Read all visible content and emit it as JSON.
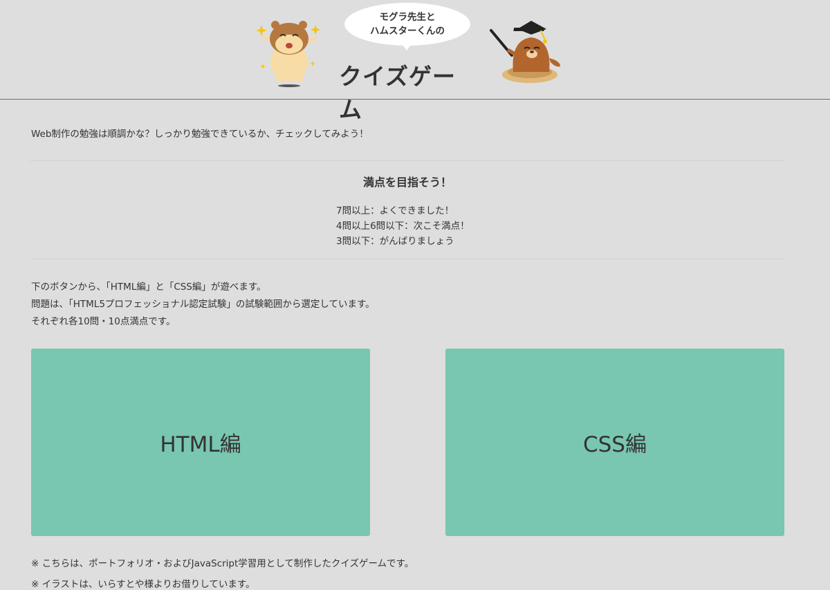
{
  "header": {
    "bubble_line1": "モグラ先生と",
    "bubble_line2": "ハムスターくんの",
    "title": "クイズゲーム"
  },
  "intro": "Web制作の勉強は順調かな？しっかり勉強できているか、チェックしてみよう！",
  "score": {
    "heading": "満点を目指そう！",
    "levels": [
      "7問以上：よくできました！",
      "4問以上6問以下：次こそ満点！",
      "3問以下：がんばりましょう"
    ]
  },
  "description": [
    "下のボタンから、「HTML編」と「CSS編」が遊べます。",
    "問題は、「HTML5プロフェッショナル認定試験」の試験範囲から選定しています。",
    "それぞれ各10問・10点満点です。"
  ],
  "buttons": {
    "html": "HTML編",
    "css": "CSS編"
  },
  "notes": [
    "※ こちらは、ポートフォリオ・およびJavaScript学習用として制作したクイズゲームです。",
    "※ イラストは、いらすとや様よりお借りしています。"
  ],
  "colors": {
    "background": "#dedede",
    "button": "#79c6b1",
    "text": "#333333"
  },
  "icons": [
    "hamster-illustration",
    "mole-teacher-illustration",
    "speech-bubble"
  ]
}
